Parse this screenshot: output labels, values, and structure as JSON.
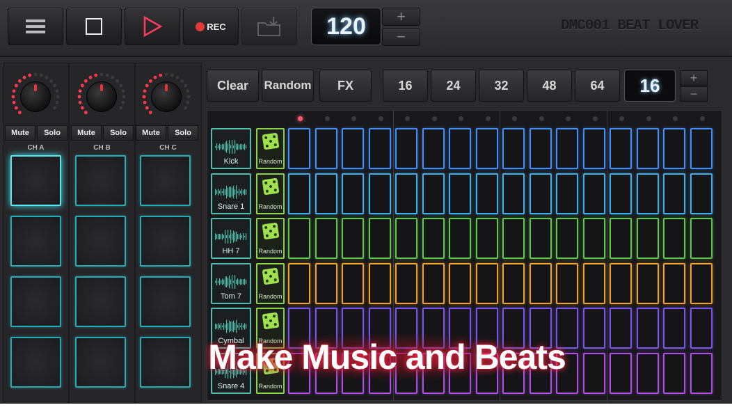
{
  "toolbar": {
    "menu_icon": "hamburger-icon",
    "stop_icon": "stop-icon",
    "play_icon": "play-icon",
    "rec_label": "REC",
    "load_icon": "folder-download-icon",
    "bpm": "120",
    "plus": "+",
    "minus": "−",
    "brand": "DMC001 BEAT LOVER"
  },
  "channels": [
    {
      "label": "CH A",
      "mute": "Mute",
      "solo": "Solo"
    },
    {
      "label": "CH B",
      "mute": "Mute",
      "solo": "Solo"
    },
    {
      "label": "CH C",
      "mute": "Mute",
      "solo": "Solo"
    }
  ],
  "sequencer": {
    "clear": "Clear",
    "random": "Random",
    "fx": "FX",
    "step_options": [
      "16",
      "24",
      "32",
      "48",
      "64"
    ],
    "steps": "16",
    "plus": "+",
    "minus": "−",
    "rows": [
      {
        "name": "Kick",
        "random": "Random",
        "color": "#3f8fff"
      },
      {
        "name": "Snare 1",
        "random": "Random",
        "color": "#3fb0ee"
      },
      {
        "name": "HH 7",
        "random": "Random",
        "color": "#5ec94a"
      },
      {
        "name": "Tom 7",
        "random": "Random",
        "color": "#f0a22a"
      },
      {
        "name": "Cymbal",
        "random": "Random",
        "color": "#7a55f0"
      },
      {
        "name": "Snare 4",
        "random": "Random",
        "color": "#b04ee8"
      }
    ]
  },
  "overlay_text": "Make Music and Beats"
}
